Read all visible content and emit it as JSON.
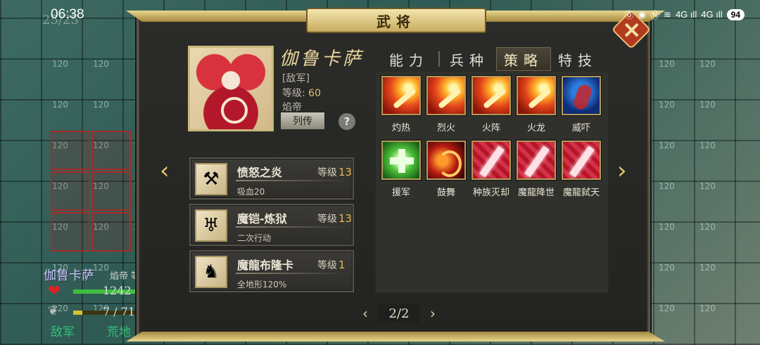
{
  "status_bar": {
    "time": "06:38",
    "icons": [
      "nfc-icon",
      "eye-icon",
      "n-icon",
      "wifi-icon",
      "signal-4g-icon",
      "signal-4g-icon"
    ],
    "signal1": "4G ıll",
    "signal2": "4G ıll",
    "battery": "94"
  },
  "map": {
    "turn_counter": "25/25",
    "cell_value": "120"
  },
  "unit": {
    "name": "伽鲁卡萨",
    "class": "焰帝 等级",
    "hp": "1242 /",
    "mp": "7 / 71",
    "faction": "敌军",
    "terrain": "荒地",
    "hp_fraction": 0.9,
    "mp_fraction": 0.1
  },
  "panel": {
    "title": "武将",
    "hero": {
      "name": "伽鲁卡萨",
      "faction": "[敌军]",
      "level_label": "等级:",
      "level": "60",
      "class": "焰帝",
      "bio_button": "列传",
      "help": "?"
    },
    "tabs": [
      {
        "label": "能力",
        "active": false
      },
      {
        "label": "兵种",
        "active": false
      },
      {
        "label": "策略",
        "active": true
      },
      {
        "label": "特技",
        "active": false
      }
    ],
    "equipment": [
      {
        "name": "愤怒之炎",
        "level_label": "等级",
        "level": "13",
        "effect": "吸血20",
        "icon": "scythe-icon"
      },
      {
        "name": "魔铠-炼狱",
        "level_label": "等级",
        "level": "13",
        "effect": "二次行动",
        "icon": "armor-icon"
      },
      {
        "name": "魔龍布隆卡",
        "level_label": "等级",
        "level": "1",
        "effect": "全地形120%",
        "icon": "dragon-mount-icon"
      }
    ],
    "skills": [
      {
        "name": "灼热",
        "type": "fire"
      },
      {
        "name": "烈火",
        "type": "fire"
      },
      {
        "name": "火阵",
        "type": "fire"
      },
      {
        "name": "火龙",
        "type": "fire"
      },
      {
        "name": "威吓",
        "type": "fear"
      },
      {
        "name": "援军",
        "type": "heal"
      },
      {
        "name": "鼓舞",
        "type": "dance"
      },
      {
        "name": "种族灭却",
        "type": "dragon"
      },
      {
        "name": "魔龍降世",
        "type": "dragon"
      },
      {
        "name": "魔龍弑天",
        "type": "dragon"
      }
    ],
    "pager": {
      "text": "2/2",
      "prev": "‹",
      "next": "›"
    },
    "nav": {
      "prev": "‹",
      "next": "›"
    }
  }
}
